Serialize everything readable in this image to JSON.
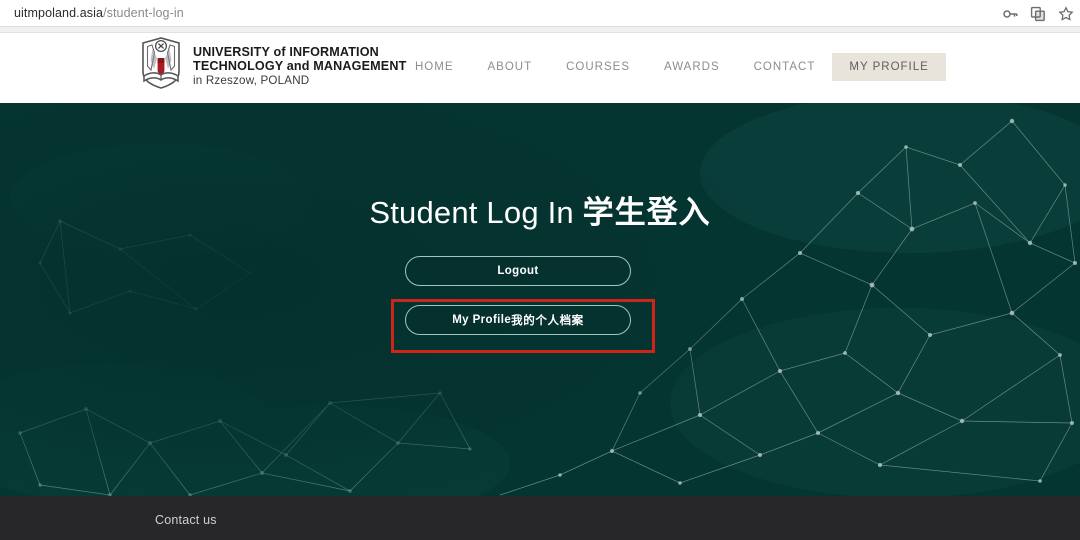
{
  "browser": {
    "url_host": "uitmpoland.asia",
    "url_path": "/student-log-in",
    "icons": {
      "password_key": "key-icon",
      "extension": "extension-icon",
      "bookmark": "star-icon"
    }
  },
  "header": {
    "logo": {
      "crest_alt": "university-crest-icon",
      "line1": "UNIVERSITY of INFORMATION",
      "line2": "TECHNOLOGY and MANAGEMENT",
      "line3": "in Rzeszow, POLAND"
    },
    "nav": [
      {
        "label": "HOME",
        "active": false
      },
      {
        "label": "ABOUT",
        "active": false
      },
      {
        "label": "COURSES",
        "active": false
      },
      {
        "label": "AWARDS",
        "active": false
      },
      {
        "label": "CONTACT",
        "active": false
      },
      {
        "label": "MY PROFILE",
        "active": true
      }
    ],
    "rule_color": "#8b2232"
  },
  "hero": {
    "title_en": "Student Log In ",
    "title_cjk": "学生登入",
    "background_color": "#053531",
    "buttons": {
      "logout": "Logout",
      "profile_en": "My Profile ",
      "profile_cjk": "我的个人档案"
    },
    "annotation": {
      "target": "My Profile button",
      "color": "#cf2418"
    }
  },
  "footer": {
    "contact_label": "Contact us",
    "background_color": "#272729"
  }
}
